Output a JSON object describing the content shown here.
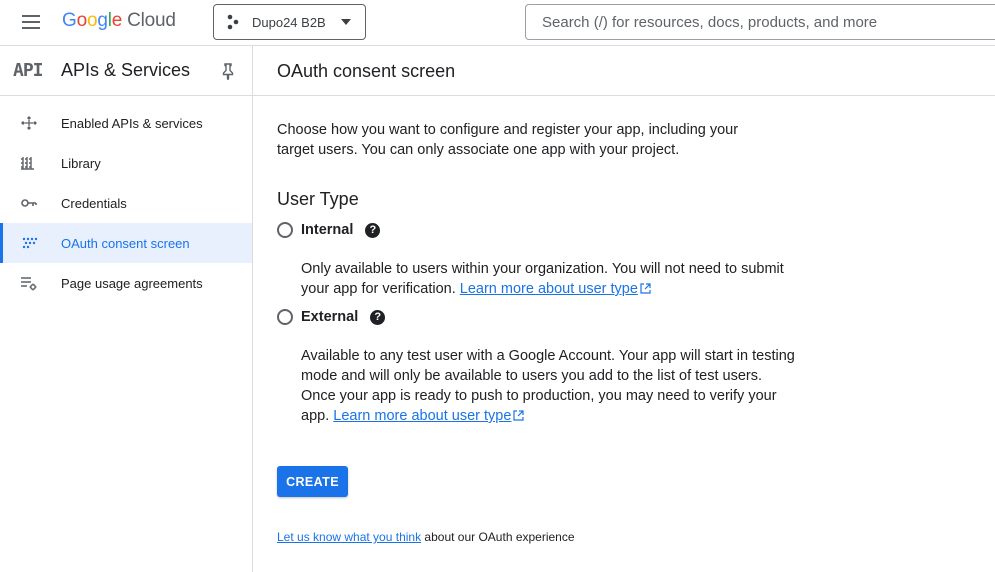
{
  "topbar": {
    "logo_letters": [
      "G",
      "o",
      "o",
      "g",
      "l",
      "e"
    ],
    "logo_suffix": "Cloud",
    "project_name": "Dupo24 B2B",
    "search_placeholder": "Search (/) for resources, docs, products, and more"
  },
  "sidebar": {
    "badge": "API",
    "title": "APIs & Services",
    "items": [
      {
        "label": "Enabled APIs & services",
        "icon": "apis-icon",
        "active": false
      },
      {
        "label": "Library",
        "icon": "library-icon",
        "active": false
      },
      {
        "label": "Credentials",
        "icon": "key-icon",
        "active": false
      },
      {
        "label": "OAuth consent screen",
        "icon": "consent-icon",
        "active": true
      },
      {
        "label": "Page usage agreements",
        "icon": "agreements-icon",
        "active": false
      }
    ]
  },
  "main": {
    "title": "OAuth consent screen",
    "intro": "Choose how you want to configure and register your app, including your target users. You can only associate one app with your project.",
    "user_type_title": "User Type",
    "options": [
      {
        "label": "Internal",
        "desc": "Only available to users within your organization. You will not need to submit your app for verification.",
        "link": "Learn more about user type"
      },
      {
        "label": "External",
        "desc": "Available to any test user with a Google Account. Your app will start in testing mode and will only be available to users you add to the list of test users. Once your app is ready to push to production, you may need to verify your app.",
        "link": "Learn more about user type"
      }
    ],
    "create_label": "CREATE",
    "feedback_link": "Let us know what you think",
    "feedback_text": " about our OAuth experience"
  },
  "colors": {
    "accent": "#1a73e8",
    "active_bg": "#e8f0fe",
    "divider": "#dadce0"
  }
}
